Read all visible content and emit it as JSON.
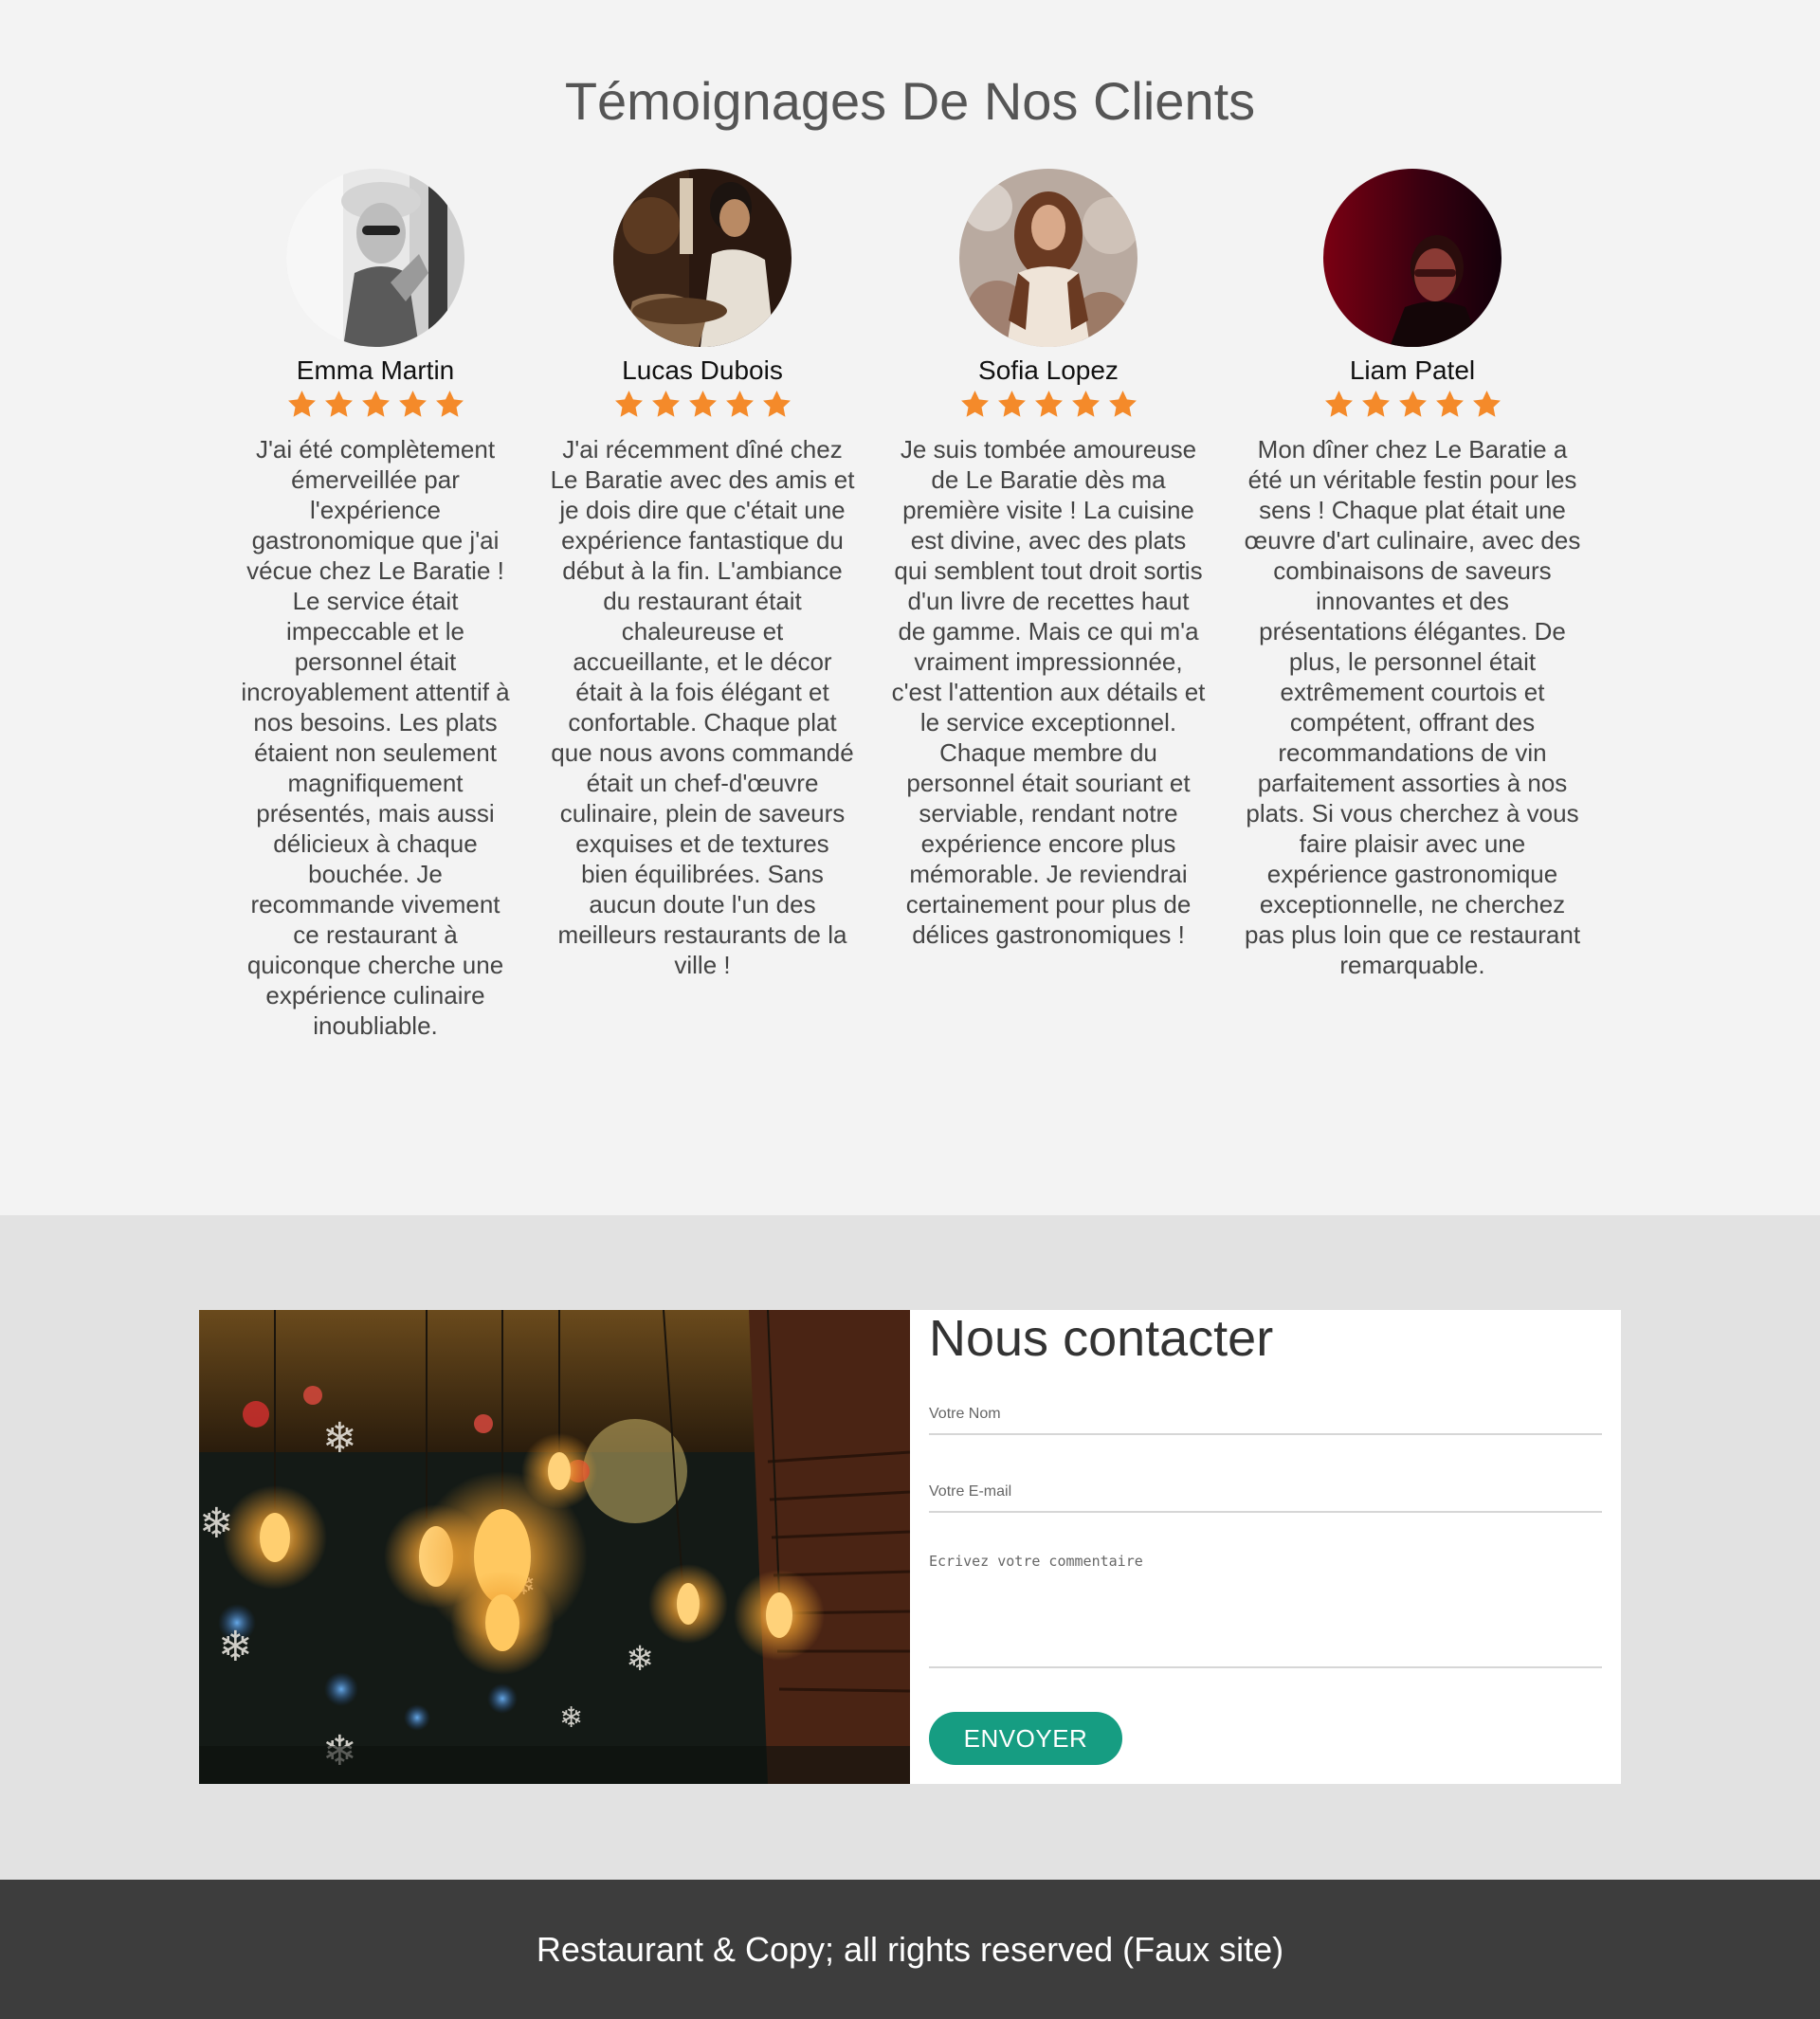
{
  "testimonials": {
    "title": "Témoignages De Nos Clients",
    "star_color": "#f48a2a",
    "items": [
      {
        "name": "Emma Martin",
        "rating": 5,
        "text": "J'ai été complètement émerveillée par l'expérience gastronomique que j'ai vécue chez Le Baratie ! Le service était impeccable et le personnel était incroyablement attentif à nos besoins. Les plats étaient non seulement magnifiquement présentés, mais aussi délicieux à chaque bouchée. Je recommande vivement ce restaurant à quiconque cherche une expérience culinaire inoubliable."
      },
      {
        "name": "Lucas Dubois",
        "rating": 5,
        "text": "J'ai récemment dîné chez Le Baratie avec des amis et je dois dire que c'était une expérience fantastique du début à la fin. L'ambiance du restaurant était chaleureuse et accueillante, et le décor était à la fois élégant et confortable. Chaque plat que nous avons commandé était un chef-d'œuvre culinaire, plein de saveurs exquises et de textures bien équilibrées. Sans aucun doute l'un des meilleurs restaurants de la ville !"
      },
      {
        "name": "Sofia Lopez",
        "rating": 5,
        "text": "Je suis tombée amoureuse de Le Baratie dès ma première visite ! La cuisine est divine, avec des plats qui semblent tout droit sortis d'un livre de recettes haut de gamme. Mais ce qui m'a vraiment impressionnée, c'est l'attention aux détails et le service exceptionnel. Chaque membre du personnel était souriant et serviable, rendant notre expérience encore plus mémorable. Je reviendrai certainement pour plus de délices gastronomiques !"
      },
      {
        "name": "Liam Patel",
        "rating": 5,
        "text": "Mon dîner chez Le Baratie a été un véritable festin pour les sens ! Chaque plat était une œuvre d'art culinaire, avec des combinaisons de saveurs innovantes et des présentations élégantes. De plus, le personnel était extrêmement courtois et compétent, offrant des recommandations de vin parfaitement assorties à nos plats. Si vous cherchez à vous faire plaisir avec une expérience gastronomique exceptionnelle, ne cherchez pas plus loin que ce restaurant remarquable."
      }
    ]
  },
  "contact": {
    "title": "Nous contacter",
    "name_placeholder": "Votre Nom",
    "email_placeholder": "Votre E-mail",
    "comment_placeholder": "Ecrivez votre commentaire",
    "submit_label": "ENVOYER",
    "accent_color": "#169d82"
  },
  "footer": {
    "text": "Restaurant & Copy; all rights reserved (Faux site)"
  }
}
